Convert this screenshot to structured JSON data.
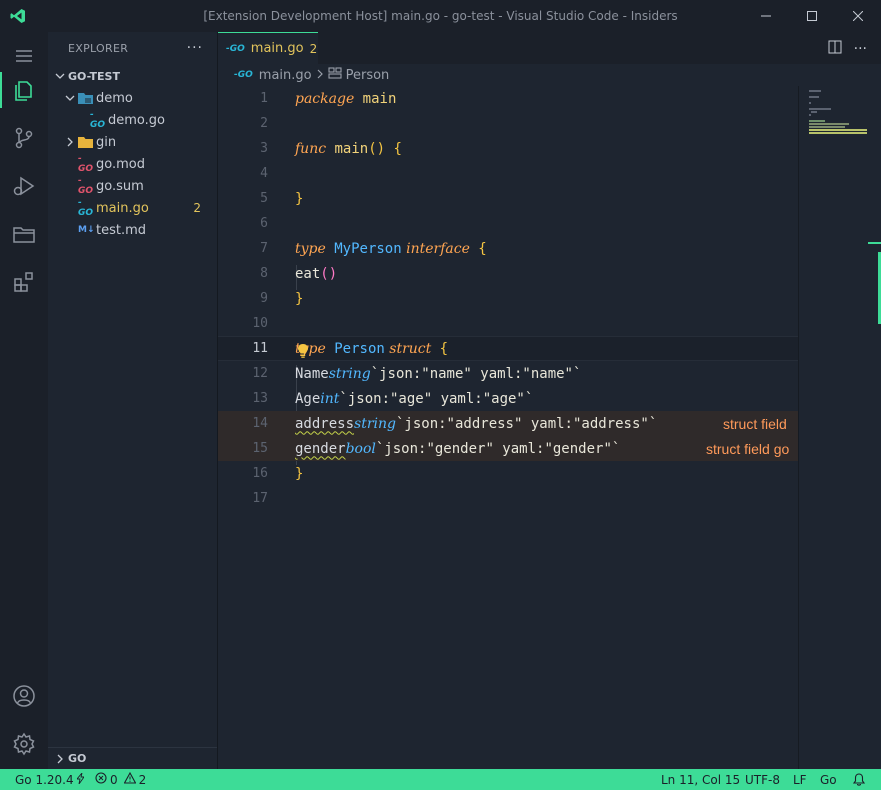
{
  "window": {
    "title": "[Extension Development Host] main.go - go-test - Visual Studio Code - Insiders",
    "controls": [
      "minimize",
      "maximize",
      "close"
    ]
  },
  "activity_bar": {
    "items": [
      "menu-icon",
      "explorer-icon",
      "source-control-icon",
      "run-debug-icon",
      "folders-icon",
      "extensions-icon"
    ],
    "bottom": [
      "account-icon",
      "settings-icon"
    ]
  },
  "sidebar": {
    "header": "EXPLORER",
    "more": "···",
    "root": "GO-TEST",
    "items": [
      {
        "label": "demo",
        "type": "folder",
        "expanded": true
      },
      {
        "label": "demo.go",
        "type": "go"
      },
      {
        "label": "gin",
        "type": "folder",
        "expanded": false
      },
      {
        "label": "go.mod",
        "type": "gomod"
      },
      {
        "label": "go.sum",
        "type": "gomod"
      },
      {
        "label": "main.go",
        "type": "go",
        "badge": "2",
        "modified": true
      },
      {
        "label": "test.md",
        "type": "md"
      }
    ],
    "outline": "GO"
  },
  "editor": {
    "tab": {
      "label": "main.go",
      "count": "2"
    },
    "breadcrumb": {
      "file": "main.go",
      "symbol": "Person"
    },
    "inlay_hints": {
      "line14": "struct field",
      "line15": "struct field go"
    },
    "line_numbers": [
      "1",
      "2",
      "3",
      "4",
      "5",
      "6",
      "7",
      "8",
      "9",
      "10",
      "11",
      "12",
      "13",
      "14",
      "15",
      "16",
      "17"
    ],
    "code": {
      "l1_kw": "package",
      "l1_name": " main",
      "l3_kw": "func",
      "l3_name": " main",
      "l3_parens": "()",
      "l3_brace": " {",
      "l5": "}",
      "l7_kw": "type",
      "l7_name": " MyPerson",
      "l7_kw2": " interface",
      "l7_brace": " {",
      "l8_name": "eat",
      "l8_parens": "()",
      "l9": "}",
      "l11_kw": "type",
      "l11_name": " Person",
      "l11_kw2": " struct",
      "l11_brace": " {",
      "l12_field": "Name",
      "l12_type": "string",
      "l12_tag": "`json:\"name\" yaml:\"name\"`",
      "l13_field": "Age",
      "l13_type": "int",
      "l13_tag": "`json:\"age\" yaml:\"age\"`",
      "l14_field": "address",
      "l14_type": "string",
      "l14_tag": "`json:\"address\" yaml:\"address\"`",
      "l15_field": "gender",
      "l15_type": "bool",
      "l15_tag": "`json:\"gender\" yaml:\"gender\"`",
      "l16": "}"
    }
  },
  "statusbar": {
    "go_version": "Go 1.20.4",
    "errors": "0",
    "warnings": "2",
    "position": "Ln 11, Col 15",
    "encoding": "UTF-8",
    "eol": "LF",
    "language": "Go"
  },
  "colors": {
    "accent": "#3ddc97",
    "keyword": "#ffa552",
    "type": "#52b8ff",
    "warning": "#e2c45c"
  }
}
